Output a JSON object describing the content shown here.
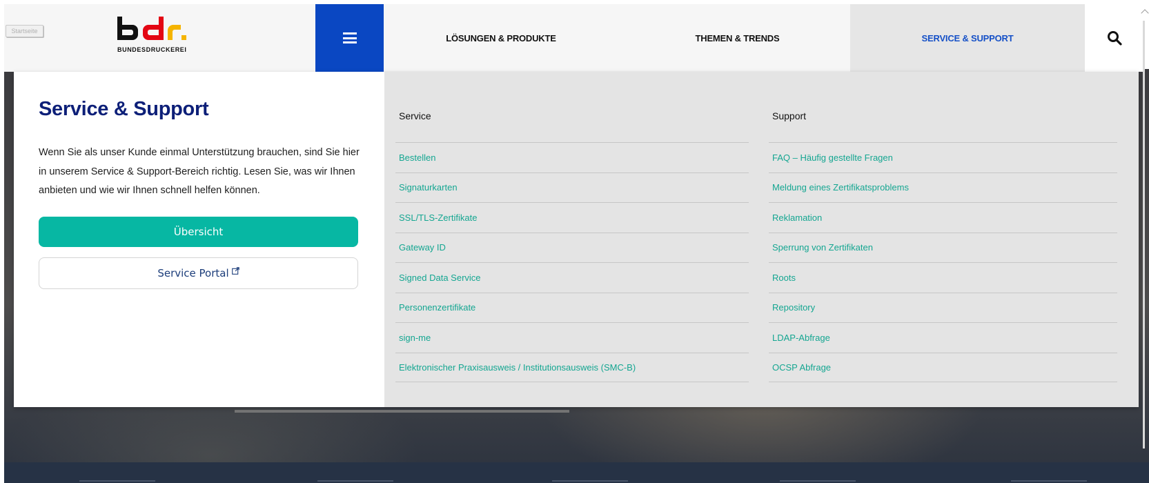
{
  "startseite_label": "Startseite",
  "brand": {
    "name": "BUNDESDRUCKEREI",
    "colors": {
      "black": "#111111",
      "red": "#e30613",
      "gold": "#f5b400"
    }
  },
  "header": {
    "menu_icon": "hamburger-icon",
    "nav": [
      {
        "label": "LÖSUNGEN & PRODUKTE"
      },
      {
        "label": "THEMEN & TRENDS"
      },
      {
        "label": "SERVICE & SUPPORT",
        "active": true
      }
    ],
    "search_icon": "search-icon"
  },
  "mega_menu": {
    "title": "Service & Support",
    "description": "Wenn Sie als unser Kunde einmal Unterstützung brauchen, sind Sie hier in unserem Service & Support-Bereich richtig. Lesen Sie, was wir Ihnen anbieten und wie wir Ihnen schnell helfen können.",
    "primary_button": "Übersicht",
    "secondary_button": "Service Portal",
    "columns": [
      {
        "heading": "Service",
        "links": [
          "Bestellen",
          "Signaturkarten",
          "SSL/TLS-Zertifikate",
          "Gateway ID",
          "Signed Data Service",
          "Personenzertifikate",
          "sign-me",
          "Elektronischer Praxisausweis / Institutionsausweis (SMC-B)"
        ]
      },
      {
        "heading": "Support",
        "links": [
          "FAQ – Häufig gestellte Fragen",
          "Meldung eines Zertifikatsproblems",
          "Reklamation",
          "Sperrung von Zertifikaten",
          "Roots",
          "Repository",
          "LDAP-Abfrage",
          "OCSP Abfrage"
        ]
      }
    ]
  },
  "colors": {
    "accent_blue": "#0a47c2",
    "title_navy": "#0d1f78",
    "link_teal": "#14a691",
    "button_teal": "#07b7a3"
  }
}
